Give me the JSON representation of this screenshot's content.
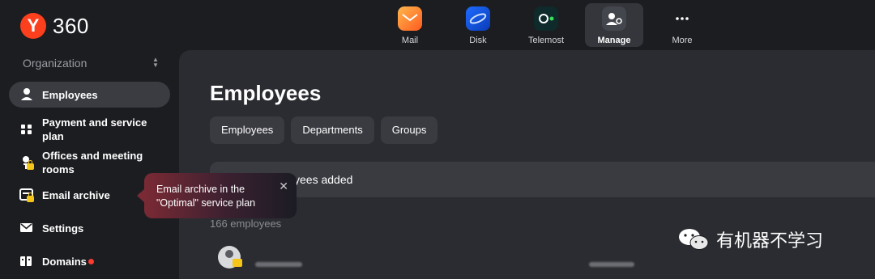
{
  "brand": {
    "logo_letter": "Y",
    "name": "360"
  },
  "apps": [
    {
      "label": "Mail",
      "icon": "mail-icon"
    },
    {
      "label": "Disk",
      "icon": "disk-icon"
    },
    {
      "label": "Telemost",
      "icon": "telemost-icon"
    },
    {
      "label": "Manage",
      "icon": "manage-icon",
      "active": true
    },
    {
      "label": "More",
      "icon": "more-icon"
    }
  ],
  "sidebar": {
    "org_label": "Organization",
    "items": [
      {
        "label": "Employees",
        "icon": "person-icon",
        "active": true
      },
      {
        "label": "Payment and service plan",
        "icon": "grid-icon"
      },
      {
        "label": "Offices and meeting rooms",
        "icon": "office-chair-icon",
        "locked": true
      },
      {
        "label": "Email archive",
        "icon": "archive-icon",
        "locked": true
      },
      {
        "label": "Settings",
        "icon": "envelope-icon"
      },
      {
        "label": "Domains",
        "icon": "domains-icon",
        "notification_dot": true
      }
    ]
  },
  "main": {
    "title": "Employees",
    "tabs": [
      "Employees",
      "Departments",
      "Groups"
    ],
    "banner_text": "yees added",
    "count_text": "166 employees"
  },
  "tooltip": {
    "text": "Email archive in the \"Optimal\" service plan"
  },
  "watermark": {
    "text": "有机器不学习"
  },
  "colors": {
    "background": "#1c1d21",
    "panel": "#2b2c31",
    "accent": "#fc3f1d",
    "lock": "#f5c518"
  }
}
